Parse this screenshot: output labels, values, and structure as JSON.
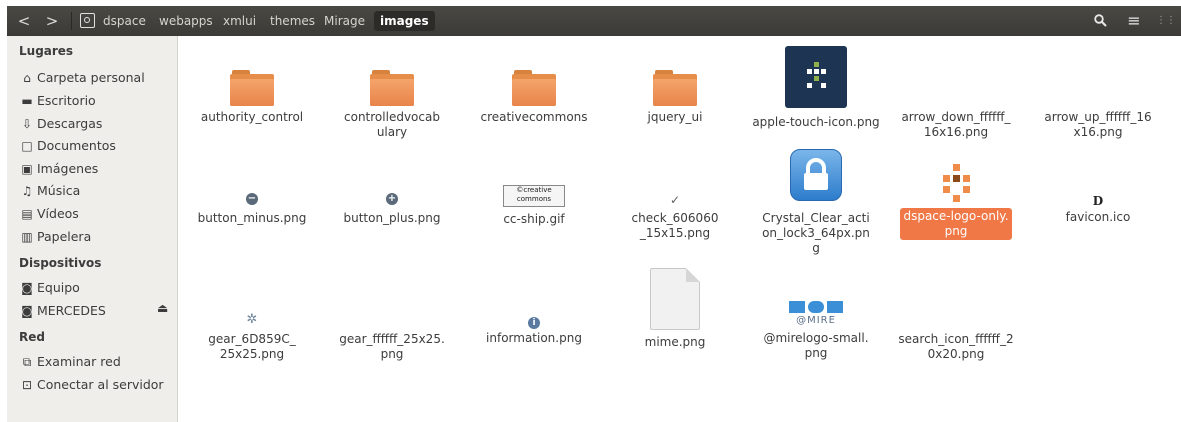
{
  "header": {
    "back": "<",
    "forward": ">",
    "path": [
      "dspace",
      "webapps",
      "xmlui",
      "themes",
      "Mirage",
      "images"
    ],
    "search_glyph": "⚲",
    "menu_glyph": "≡",
    "grid_glyph": "⋮⋮"
  },
  "sidebar": {
    "lugares": "Lugares",
    "places": [
      "Carpeta personal",
      "Escritorio",
      "Descargas",
      "Documentos",
      "Imágenes",
      "Música",
      "Vídeos",
      "Papelera"
    ],
    "dispositivos": "Dispositivos",
    "devices": [
      "Equipo",
      "MERCEDES"
    ],
    "red": "Red",
    "network": [
      "Examinar red",
      "Conectar al servidor"
    ]
  },
  "files": [
    {
      "name": "authority_control",
      "type": "folder"
    },
    {
      "name": "controlledvocabulary",
      "type": "folder"
    },
    {
      "name": "creativecommons",
      "type": "folder"
    },
    {
      "name": "jquery_ui",
      "type": "folder"
    },
    {
      "name": "apple-touch-icon.png",
      "type": "image"
    },
    {
      "name": "arrow_down_ffffff_16x16.png",
      "type": "image"
    },
    {
      "name": "arrow_up_ffffff_16x16.png",
      "type": "image"
    },
    {
      "name": "button_minus.png",
      "type": "image"
    },
    {
      "name": "button_plus.png",
      "type": "image"
    },
    {
      "name": "cc-ship.gif",
      "type": "image",
      "thumb_text": "©creative commons"
    },
    {
      "name": "check_606060_15x15.png",
      "type": "image"
    },
    {
      "name": "Crystal_Clear_action_lock3_64px.png",
      "type": "image"
    },
    {
      "name": "dspace-logo-only.png",
      "type": "image",
      "selected": true
    },
    {
      "name": "favicon.ico",
      "type": "image",
      "thumb_text": "D"
    },
    {
      "name": "gear_6D859C_25x25.png",
      "type": "image"
    },
    {
      "name": "gear_ffffff_25x25.png",
      "type": "image"
    },
    {
      "name": "information.png",
      "type": "image"
    },
    {
      "name": "mime.png",
      "type": "image"
    },
    {
      "name": "@mirelogo-small.png",
      "type": "image",
      "thumb_text": "@MIRE"
    },
    {
      "name": "search_icon_ffffff_20x20.png",
      "type": "image"
    }
  ],
  "colors": {
    "selection": "#f07746",
    "folder": "#e8844a",
    "header": "#3b3a36",
    "sidebar": "#efeeeb"
  }
}
